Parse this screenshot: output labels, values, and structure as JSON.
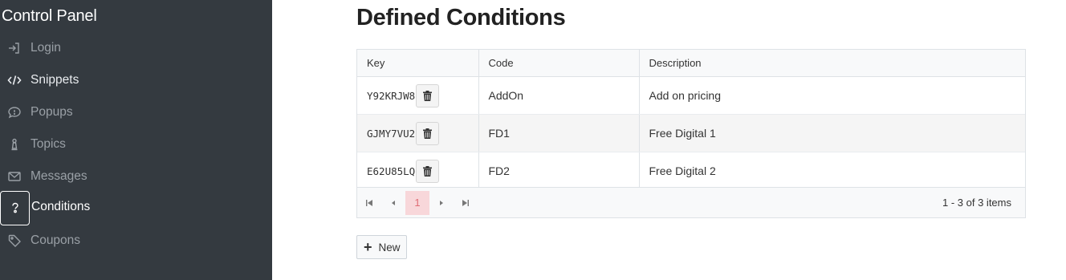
{
  "sidebar": {
    "title": "Control Panel",
    "items": [
      {
        "label": "Login",
        "icon": "login-icon"
      },
      {
        "label": "Snippets",
        "icon": "code-icon"
      },
      {
        "label": "Popups",
        "icon": "chat-bubble-icon"
      },
      {
        "label": "Topics",
        "icon": "chess-pawn-icon"
      },
      {
        "label": "Messages",
        "icon": "envelope-icon"
      },
      {
        "label": "Conditions",
        "icon": "question-icon"
      },
      {
        "label": "Coupons",
        "icon": "tag-icon"
      }
    ],
    "active": "Conditions"
  },
  "main": {
    "title": "Defined Conditions",
    "table": {
      "columns": [
        "Key",
        "Code",
        "Description"
      ],
      "rows": [
        {
          "key": "Y92KRJW8",
          "code": "AddOn",
          "description": "Add on pricing"
        },
        {
          "key": "GJMY7VU2",
          "code": "FD1",
          "description": "Free Digital 1"
        },
        {
          "key": "E62U85LQ",
          "code": "FD2",
          "description": "Free Digital 2"
        }
      ]
    },
    "pager": {
      "current_page": "1",
      "info": "1 - 3 of 3 items"
    },
    "new_button_label": "New"
  },
  "colors": {
    "sidebar_bg": "#343a40",
    "current_page_bg": "#f8d7da",
    "current_page_text": "#e06c75"
  }
}
